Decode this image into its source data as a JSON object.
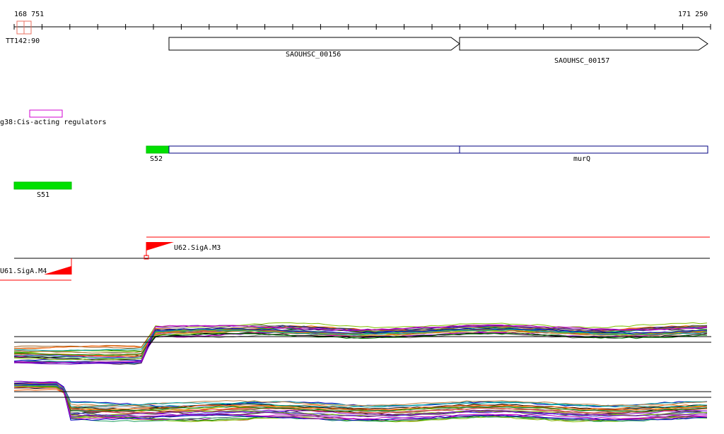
{
  "ruler": {
    "start_label": "168 751",
    "end_label": "171 250",
    "terminator_label": "TT142:90"
  },
  "genes": [
    {
      "label": "SAOUHSC_00156"
    },
    {
      "label": "SAOUHSC_00157"
    }
  ],
  "regulators": {
    "label": "g38:Cis-acting regulators",
    "color": "#d000d0"
  },
  "transcripts": {
    "s52_label": "S52",
    "murq_label": "murQ",
    "s51_label": "S51",
    "highlight_color": "#00e000",
    "outline_color": "#000080"
  },
  "promoters": [
    {
      "label": "U62.SigA.M3",
      "strand": "+"
    },
    {
      "label": "U61.SigA.M4",
      "strand": "-"
    }
  ],
  "colors": {
    "promoter": "#ff0000",
    "terminator": "#e87060"
  },
  "expression": {
    "upper_panel": "forward strand expression profiles",
    "lower_panel": "reverse strand expression profiles",
    "palette": [
      "#000000",
      "#808080",
      "#c08040",
      "#ff6000",
      "#008000",
      "#80c000",
      "#0000c0",
      "#8000c0",
      "#c000c0",
      "#00a0a0",
      "#a06020",
      "#404040",
      "#c0c000",
      "#6060ff",
      "#e04040",
      "#20a060"
    ]
  }
}
